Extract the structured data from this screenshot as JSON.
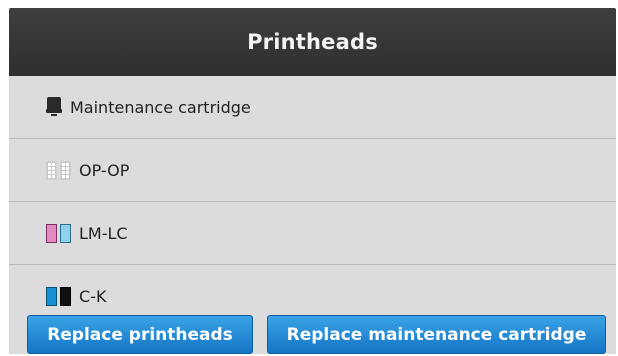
{
  "header": {
    "title": "Printheads"
  },
  "items": [
    {
      "label": "Maintenance cartridge",
      "icon": "maintenance-cartridge-icon"
    },
    {
      "label": "OP-OP",
      "icon": "optimizer-printhead-icon",
      "colors": [
        "#ffffff",
        "#ffffff"
      ]
    },
    {
      "label": "LM-LC",
      "icon": "light-magenta-light-cyan-printhead-icon",
      "colors": [
        "#e48ac3",
        "#8ed2ef"
      ]
    },
    {
      "label": "C-K",
      "icon": "cyan-black-printhead-icon",
      "colors": [
        "#1792d4",
        "#111111"
      ]
    }
  ],
  "actions": {
    "replace_printheads": "Replace printheads",
    "replace_maintenance_cartridge": "Replace maintenance cartridge"
  },
  "theme": {
    "header_bg": "#333333",
    "list_bg": "#dcdcdc",
    "button_blue": "#1f86d2"
  }
}
